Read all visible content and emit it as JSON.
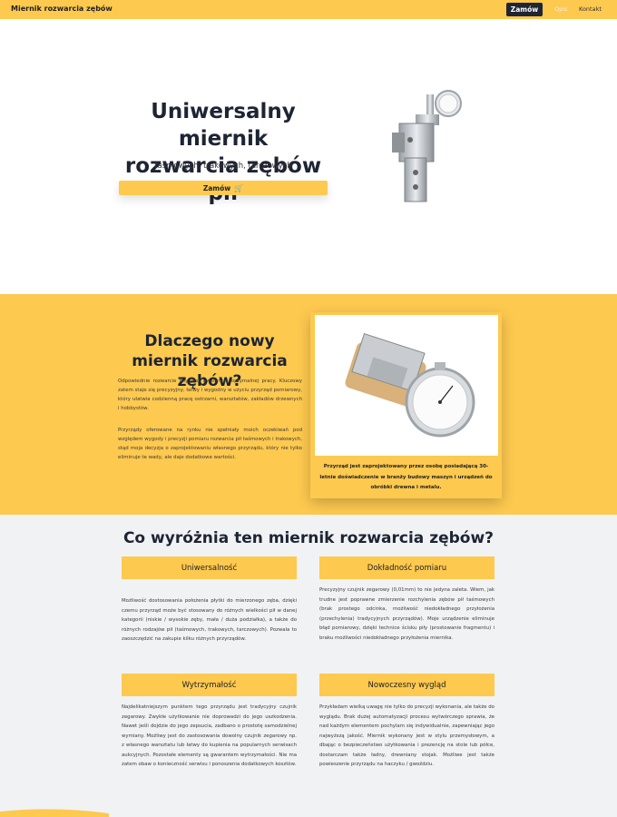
{
  "navbar": {
    "brand": "Miernik rozwarcia zębów",
    "order_button": "Zamów",
    "links": [
      "Opis",
      "Kontakt"
    ]
  },
  "hero": {
    "title": "Uniwersalny miernik rozwarcia zębów pił",
    "subtitle": "taśmowych, trakowych, tarczowych",
    "button": "Zamów",
    "button_icon": "cart-icon"
  },
  "why": {
    "title": "Dlaczego nowy miernik rozwarcia zębów?",
    "paragraphs": [
      "Odpowiednie rozwarcie piły jest gwarancją optymalnej pracy. Kluczowy zatem staje się precyzyjny, łatwy i wygodny w użyciu przyrząd pomiarowy, który ułatwia codzienną pracę ostrzarni, warsztatów, zakładów drzewnych i hobbystów.",
      "Przyrządy oferowane na rynku nie spełniały moich oczekiwań pod względem wygody i precyzji pomiaru rozwarcia pił taśmowych i trakowych, stąd moja decyzja o zaprojektowaniu własnego przyrządu, który nie tylko eliminuje te wady, ale daje dodatkowe wartości."
    ],
    "card_caption": "Przyrząd jest zaprojektowany przez osobę posiadającą 30-letnie doświadczenie w branży budowy maszyn i urządzeń do obróbki drewna i metalu."
  },
  "features": {
    "title": "Co wyróżnia ten miernik rozwarcia zębów?",
    "items": [
      {
        "title": "Uniwersalność",
        "text": "Możliwość dostosowania położenia płytki do mierzonego zęba, dzięki czemu przyrząd może być stosowany do różnych wielkości pił w danej kategorii (niskie / wysokie zęby, mała / duża podziałka), a także do różnych rodzajów pił (taśmowych, trakowych, tarczowych). Pozwala to zaoszczędzić na zakupie kilku różnych przyrządów."
      },
      {
        "title": "Dokładność pomiaru",
        "text": "Precyzyjny czujnik zegarowy (0,01mm) to nie jedyna zaleta. Wiem, jak trudne jest poprawne zmierzenie rozchylenia zębów pił taśmowych (brak prostego odcinka, możliwość niedokładnego przyłożenia (przechylenia) tradycyjnych przyrządów). Moje urządzenie eliminuje błąd pomiarowy, dzięki technice ścisku piły (prostowanie fragmentu) i braku możliwości niedokładnego przyłożenia miernika."
      },
      {
        "title": "Wytrzymałość",
        "text": "Najdelikatniejszym punktem tego przyrządu jest tradycyjny czujnik zegarowy. Zwykłe użytkowanie nie doprowadzi do jego uszkodzenia. Nawet jeśli dojdzie do jego zepsucia, zadbano o prostotę samodzielnej wymiany. Możliwy jest do zastosowania dowolny czujnik zegarowy np. z własnego warsztatu lub łatwy do kupienia na popularnych serwisach aukcyjnych. Pozostałe elementy są gwarantem wytrzymałości. Nie ma zatem obaw o konieczność serwisu i ponoszenia dodatkowych kosztów."
      },
      {
        "title": "Nowoczesny wygląd",
        "text": "Przykładam wielką uwagę nie tylko do precyzji wykonania, ale także do wyglądu. Brak dużej automatyzacji procesu wytwórczego sprawia, że nad każdym elementem pochylam się indywidualnie, zapewniając jego najwyższą jakość. Miernik wykonany jest w stylu przemysłowym, a dbając o bezpieczeństwo użytkowania i prezencję na stole lub półce, dostarczam także ładny, drewniany stojak. Możliwe jest także powieszenie przyrządu na haczyku / gwoździu."
      }
    ]
  },
  "colors": {
    "accent": "#fdc94f",
    "dark": "#1d2433",
    "light_bg": "#f1f2f4"
  }
}
